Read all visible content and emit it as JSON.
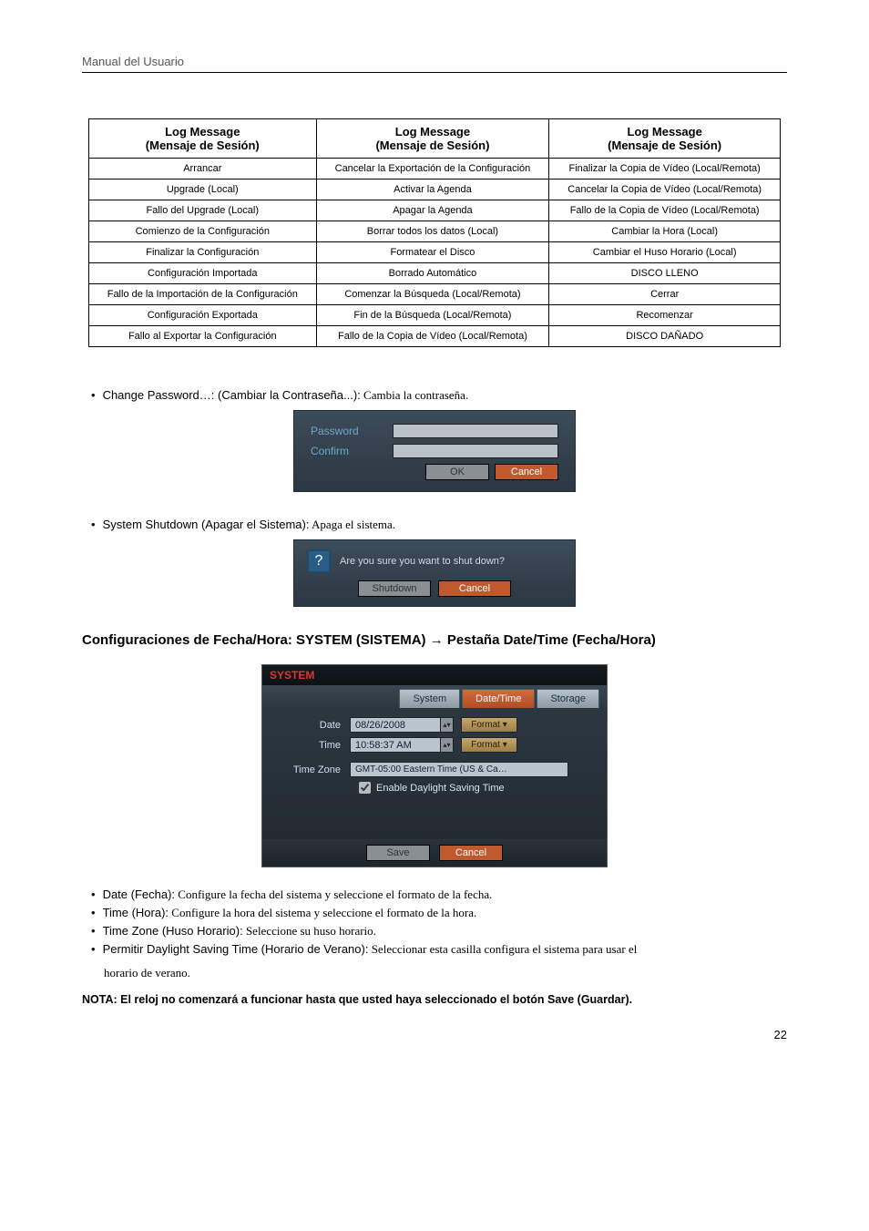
{
  "header_title": "Manual del Usuario",
  "log_table": {
    "head1": "Log Message",
    "head1_sub": "(Mensaje de Sesión)",
    "head2": "Log Message",
    "head2_sub": "(Mensaje de Sesión)",
    "head3": "Log Message",
    "head3_sub": "(Mensaje de Sesión)",
    "rows": [
      {
        "c1": "Arrancar",
        "c2": "Cancelar la Exportación de la Configuración",
        "c3": "Finalizar la Copia de Vídeo (Local/Remota)"
      },
      {
        "c1": "Upgrade (Local)",
        "c2": "Activar la Agenda",
        "c3": "Cancelar la Copia de Vídeo (Local/Remota)"
      },
      {
        "c1": "Fallo del Upgrade (Local)",
        "c2": "Apagar la Agenda",
        "c3": "Fallo de la Copia de Vídeo (Local/Remota)"
      },
      {
        "c1": "Comienzo de la Configuración",
        "c2": "Borrar todos los datos (Local)",
        "c3": "Cambiar la Hora (Local)"
      },
      {
        "c1": "Finalizar la Configuración",
        "c2": "Formatear el Disco",
        "c3": "Cambiar el Huso Horario (Local)"
      },
      {
        "c1": "Configuración Importada",
        "c2": "Borrado Automático",
        "c3": "DISCO LLENO"
      },
      {
        "c1": "Fallo de la Importación de la Configuración",
        "c2": "Comenzar la Búsqueda (Local/Remota)",
        "c3": "Cerrar"
      },
      {
        "c1": "Configuración Exportada",
        "c2": "Fin de la Búsqueda (Local/Remota)",
        "c3": "Recomenzar"
      },
      {
        "c1": "Fallo al Exportar la Configuración",
        "c2": "Fallo de la Copia de Vídeo (Local/Remota)",
        "c3": "DISCO DAÑADO"
      }
    ]
  },
  "change_pw": {
    "label": "Change Password…: (Cambiar la Contraseña...):",
    "desc": " Cambia la contraseña.",
    "dlg_password": "Password",
    "dlg_confirm": "Confirm",
    "ok": "OK",
    "cancel": "Cancel"
  },
  "shutdown": {
    "label": "System Shutdown (Apagar el Sistema):",
    "desc": " Apaga el sistema.",
    "msg": "Are you sure you want to shut down?",
    "btn_shut": "Shutdown",
    "btn_cancel": "Cancel"
  },
  "section_head": "Configuraciones de Fecha/Hora: SYSTEM  (SISTEMA) → Pestaña Date/Time (Fecha/Hora)",
  "sys_dialog": {
    "title": "SYSTEM",
    "tab_system": "System",
    "tab_datetime": "Date/Time",
    "tab_storage": "Storage",
    "lab_date": "Date",
    "val_date": "08/26/2008",
    "lab_time": "Time",
    "val_time": "10:58:37 AM",
    "btn_format": "Format",
    "lab_tz": "Time Zone",
    "val_tz": "GMT-05:00  Eastern Time (US & Ca…",
    "check_label": "Enable Daylight Saving Time",
    "btn_save": "Save",
    "btn_cancel": "Cancel"
  },
  "desc_items": {
    "date": {
      "t": "Date (Fecha):",
      "e": " Configure la fecha del sistema y seleccione el formato de la fecha."
    },
    "time": {
      "t": "Time (Hora):",
      "e": " Configure la hora del sistema y seleccione el formato de la hora."
    },
    "tz": {
      "t": "Time Zone (Huso Horario):",
      "e": " Seleccione su huso horario."
    },
    "dst": {
      "t": "Permitir Daylight Saving Time (Horario de Verano):",
      "e": " Seleccionar esta casilla configura el sistema para usar el"
    },
    "dst2": "horario de verano."
  },
  "note": "NOTA: El reloj no comenzará a funcionar hasta que usted haya seleccionado el botón Save (Guardar).",
  "page_number": "22"
}
